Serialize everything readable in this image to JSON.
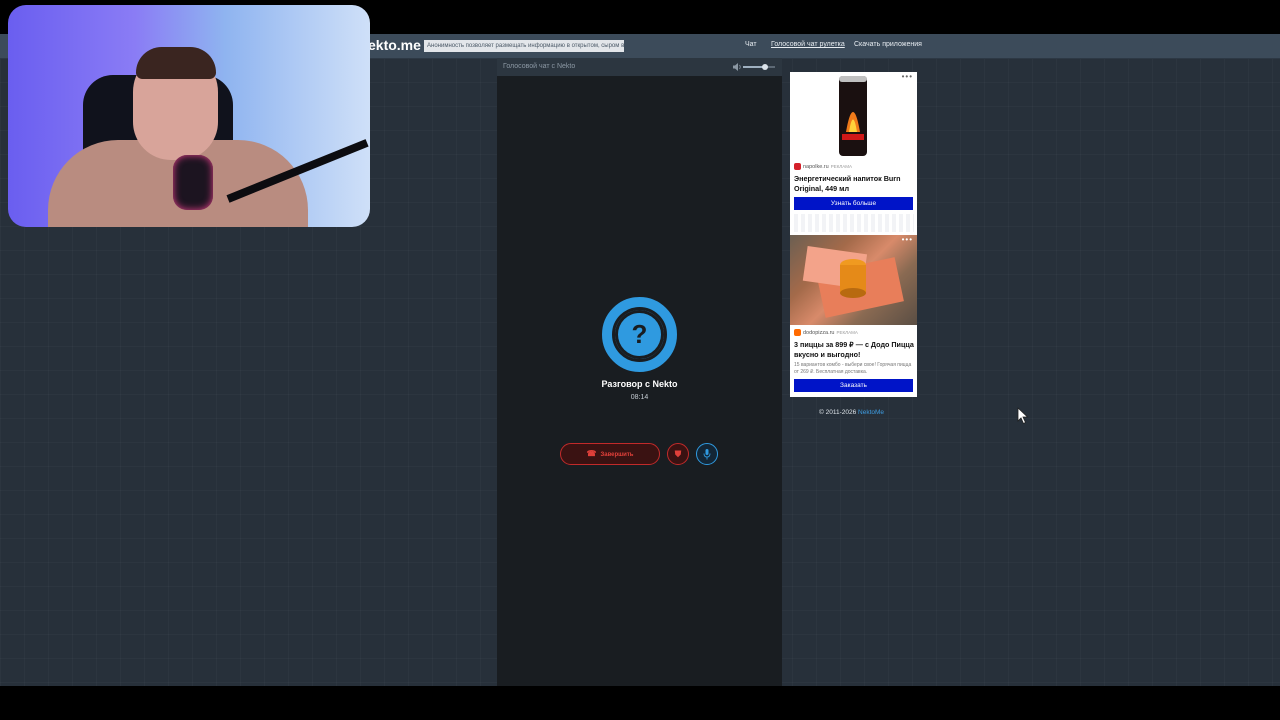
{
  "header": {
    "logo": "ekto.me",
    "slogan": "Анонимность позволяет размещать информацию в открытом, сыром виде!",
    "nav": [
      {
        "label": "Чат",
        "active": false
      },
      {
        "label": "Голосовой чат рулетка",
        "active": true
      },
      {
        "label": "Скачать приложения",
        "active": false
      }
    ]
  },
  "chat": {
    "header_title": "Голосовой чат с Nekto",
    "volume_level": 0.7,
    "avatar_glyph": "?",
    "conversation_title": "Разговор с Nekto",
    "timer": "08:14",
    "end_button_label": "Завершить",
    "accent_color": "#2f9ae0",
    "danger_color": "#c22a2a"
  },
  "ads": [
    {
      "source": "napolke.ru",
      "tag": "РЕКЛАМА",
      "title": "Энергетический напиток Burn Original, 449 мл",
      "button": "Узнать больше",
      "image": "burn-can-image"
    },
    {
      "source": "dodopizza.ru",
      "tag": "РЕКЛАМА",
      "title": "3 пиццы за 899 ₽ — с Додо Пицца вкусно и выгодно!",
      "description": "15 вариантов комбо - выбери свое! Горячая пицца от 269 ₽. Бесплатная доставка.",
      "button": "Заказать",
      "image": "pizza-boxes-image"
    }
  ],
  "footer": {
    "copyright": "© 2011-2026",
    "link": "NektoMe"
  }
}
